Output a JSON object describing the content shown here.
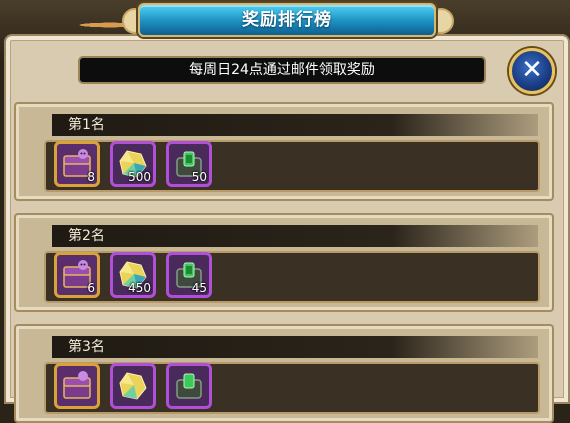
{
  "title": "奖励排行榜",
  "notice": "每周日24点通过邮件领取奖励",
  "close_icon": "✕",
  "ranks": [
    {
      "label": "第1名",
      "rewards": [
        {
          "icon": "purple-chest-icon",
          "count": "8"
        },
        {
          "icon": "crystal-icon",
          "count": "500"
        },
        {
          "icon": "green-gem-chest-icon",
          "count": "50"
        }
      ]
    },
    {
      "label": "第2名",
      "rewards": [
        {
          "icon": "purple-chest-icon",
          "count": "6"
        },
        {
          "icon": "crystal-icon",
          "count": "450"
        },
        {
          "icon": "green-gem-chest-icon",
          "count": "45"
        }
      ]
    },
    {
      "label": "第3名",
      "rewards": [
        {
          "icon": "purple-chest-icon",
          "count": ""
        },
        {
          "icon": "crystal-icon",
          "count": ""
        },
        {
          "icon": "green-gem-chest-icon",
          "count": ""
        }
      ]
    }
  ],
  "colors": {
    "title_blue": "#1c8fc1",
    "frame_gold": "#d9a33a",
    "frame_purple": "#b04fd8"
  }
}
